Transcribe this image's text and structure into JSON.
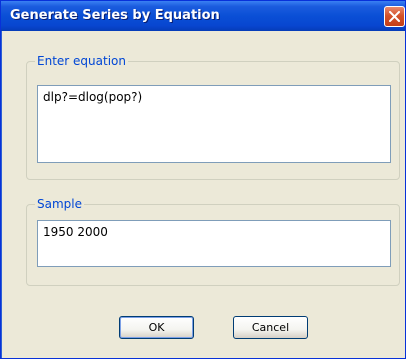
{
  "dialog": {
    "title": "Generate Series by Equation",
    "accent_color": "#0a4fd6",
    "close_icon": "close-x-icon"
  },
  "equation_group": {
    "label": "Enter equation",
    "value": "dlp?=dlog(pop?)"
  },
  "sample_group": {
    "label": "Sample",
    "value": "1950 2000"
  },
  "buttons": {
    "ok_label": "OK",
    "cancel_label": "Cancel"
  }
}
